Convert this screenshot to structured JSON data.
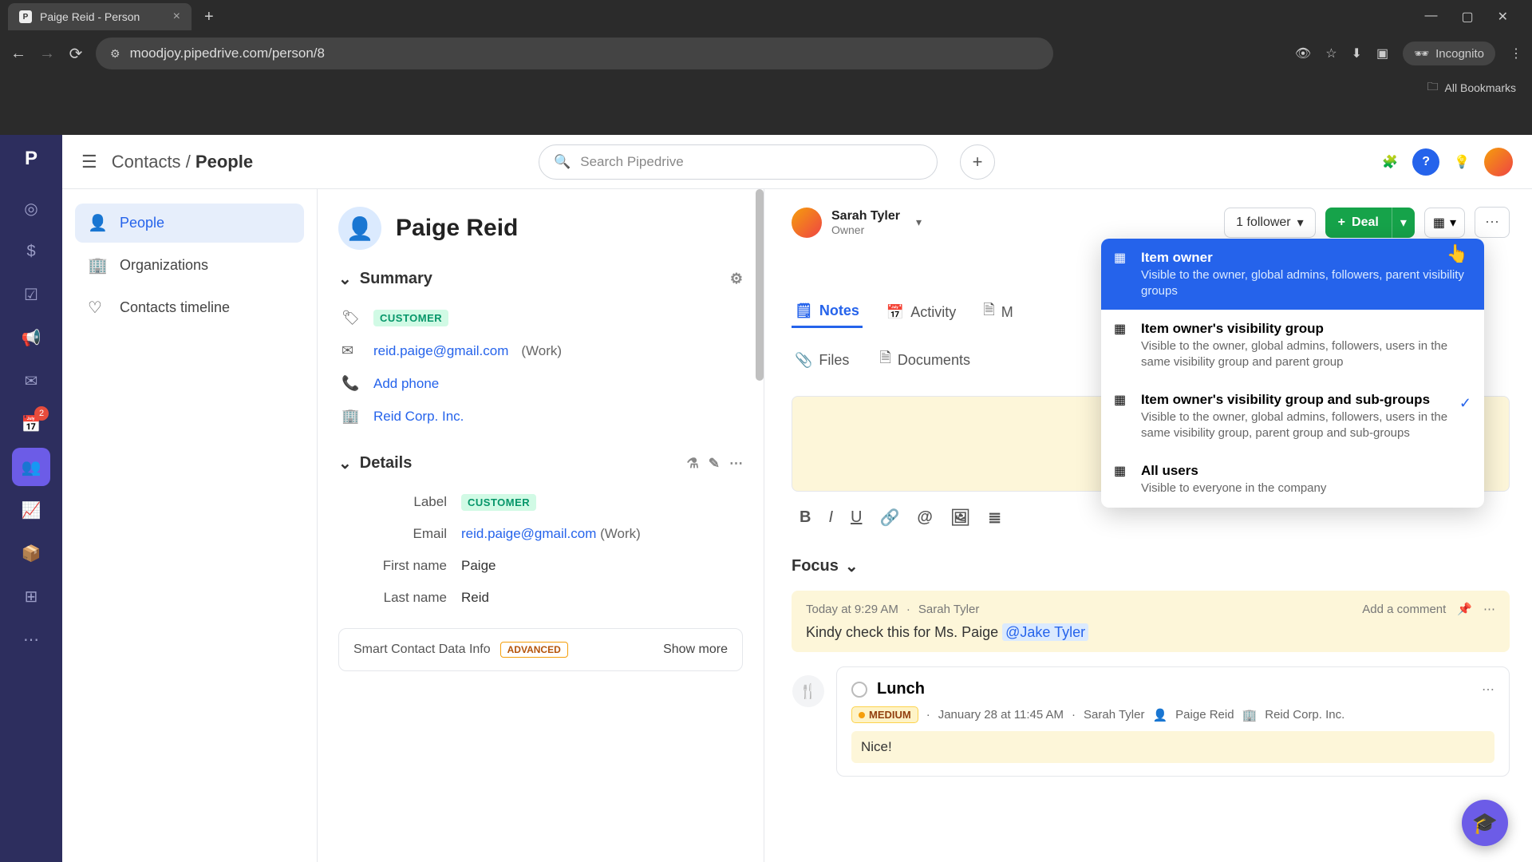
{
  "browser": {
    "tab_title": "Paige Reid - Person",
    "url": "moodjoy.pipedrive.com/person/8",
    "incognito_label": "Incognito",
    "bookmarks_label": "All Bookmarks"
  },
  "topbar": {
    "breadcrumb_root": "Contacts",
    "breadcrumb_current": "People",
    "search_placeholder": "Search Pipedrive"
  },
  "rail_badge": "2",
  "side_nav": {
    "items": [
      {
        "label": "People"
      },
      {
        "label": "Organizations"
      },
      {
        "label": "Contacts timeline"
      }
    ]
  },
  "person": {
    "name": "Paige Reid",
    "summary_title": "Summary",
    "label_badge": "CUSTOMER",
    "email": "reid.paige@gmail.com",
    "email_type": "(Work)",
    "add_phone": "Add phone",
    "org": "Reid Corp. Inc.",
    "details_title": "Details",
    "details": {
      "label_field": "Label",
      "label_value": "CUSTOMER",
      "email_field": "Email",
      "email_value": "reid.paige@gmail.com",
      "email_type": "(Work)",
      "first_name_field": "First name",
      "first_name_value": "Paige",
      "last_name_field": "Last name",
      "last_name_value": "Reid"
    },
    "smart_label": "Smart Contact Data Info",
    "advanced_badge": "ADVANCED",
    "show_more": "Show more"
  },
  "header": {
    "owner_name": "Sarah Tyler",
    "owner_role": "Owner",
    "followers_label": "1 follower",
    "deal_label": "Deal"
  },
  "visibility": {
    "opt1_title": "Item owner",
    "opt1_desc": "Visible to the owner, global admins, followers, parent visibility groups",
    "opt2_title": "Item owner's visibility group",
    "opt2_desc": "Visible to the owner, global admins, followers, users in the same visibility group and parent group",
    "opt3_title": "Item owner's visibility group and sub-groups",
    "opt3_desc": "Visible to the owner, global admins, followers, users in the same visibility group, parent group and sub-groups",
    "opt4_title": "All users",
    "opt4_desc": "Visible to everyone in the company"
  },
  "tabs": {
    "notes": "Notes",
    "activity": "Activity",
    "m_label": "M",
    "files": "Files",
    "documents": "Documents"
  },
  "focus_label": "Focus",
  "note": {
    "time": "Today at 9:29 AM",
    "author": "Sarah Tyler",
    "add_comment": "Add a comment",
    "body_text": "Kindy check this for Ms. Paige ",
    "mention": "@Jake Tyler"
  },
  "activity": {
    "title": "Lunch",
    "priority": "MEDIUM",
    "time": "January 28 at 11:45 AM",
    "owner": "Sarah Tyler",
    "contact": "Paige Reid",
    "org": "Reid Corp. Inc.",
    "note": "Nice!"
  }
}
